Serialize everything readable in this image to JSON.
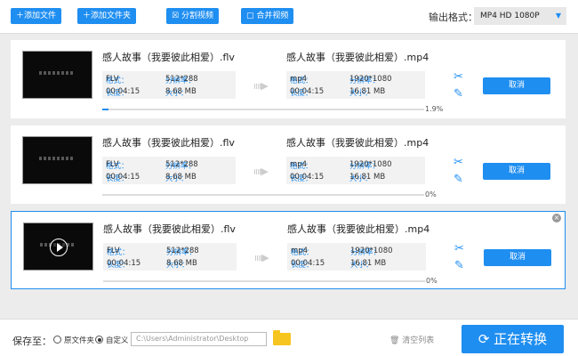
{
  "toolbar": {
    "add_file": "添加文件",
    "add_folder": "添加文件夹",
    "split_video": "分割视频",
    "merge_video": "合并视频",
    "output_format_label": "输出格式：",
    "output_format_value": "MP4  HD 1080P"
  },
  "tasks": [
    {
      "src_title": "感人故事（我要彼此相爱）.flv",
      "src_format_k": "格式：",
      "src_format": "FLV",
      "src_res_k": "分辨率：",
      "src_res": "512*288",
      "src_dur_k": "长度：",
      "src_dur": "00:04:15",
      "src_size_k": "大小：",
      "src_size": "8.68 MB",
      "dst_title": "感人故事（我要彼此相爱）.mp4",
      "dst_format": "mp4",
      "dst_res": "1920*1080",
      "dst_dur": "00:04:15",
      "dst_size": "16.81 MB",
      "cancel": "取消",
      "progress_text": "1.9%",
      "progress": 1.9,
      "selected": false
    },
    {
      "src_title": "感人故事（我要彼此相爱）.flv",
      "src_format_k": "格式：",
      "src_format": "FLV",
      "src_res_k": "分辨率：",
      "src_res": "512*288",
      "src_dur_k": "长度：",
      "src_dur": "00:04:15",
      "src_size_k": "大小：",
      "src_size": "8.68 MB",
      "dst_title": "感人故事（我要彼此相爱）.mp4",
      "dst_format": "mp4",
      "dst_res": "1920*1080",
      "dst_dur": "00:04:15",
      "dst_size": "16.81 MB",
      "cancel": "取消",
      "progress_text": "0%",
      "progress": 0,
      "selected": false
    },
    {
      "src_title": "感人故事（我要彼此相爱）.flv",
      "src_format_k": "格式：",
      "src_format": "FLV",
      "src_res_k": "分辨率：",
      "src_res": "512*288",
      "src_dur_k": "长度：",
      "src_dur": "00:04:15",
      "src_size_k": "大小：",
      "src_size": "8.68 MB",
      "dst_title": "感人故事（我要彼此相爱）.mp4",
      "dst_format": "mp4",
      "dst_res": "1920*1080",
      "dst_dur": "00:04:15",
      "dst_size": "16.81 MB",
      "cancel": "取消",
      "progress_text": "0%",
      "progress": 0,
      "selected": true
    }
  ],
  "bottom": {
    "save_to": "保存至：",
    "opt_source": "原文件夹",
    "opt_custom": "自定义",
    "path": "C:\\Users\\Administrator\\Desktop",
    "clear_list": "清空列表",
    "converting": "正在转换"
  },
  "colors": {
    "accent": "#1f8ef1"
  }
}
